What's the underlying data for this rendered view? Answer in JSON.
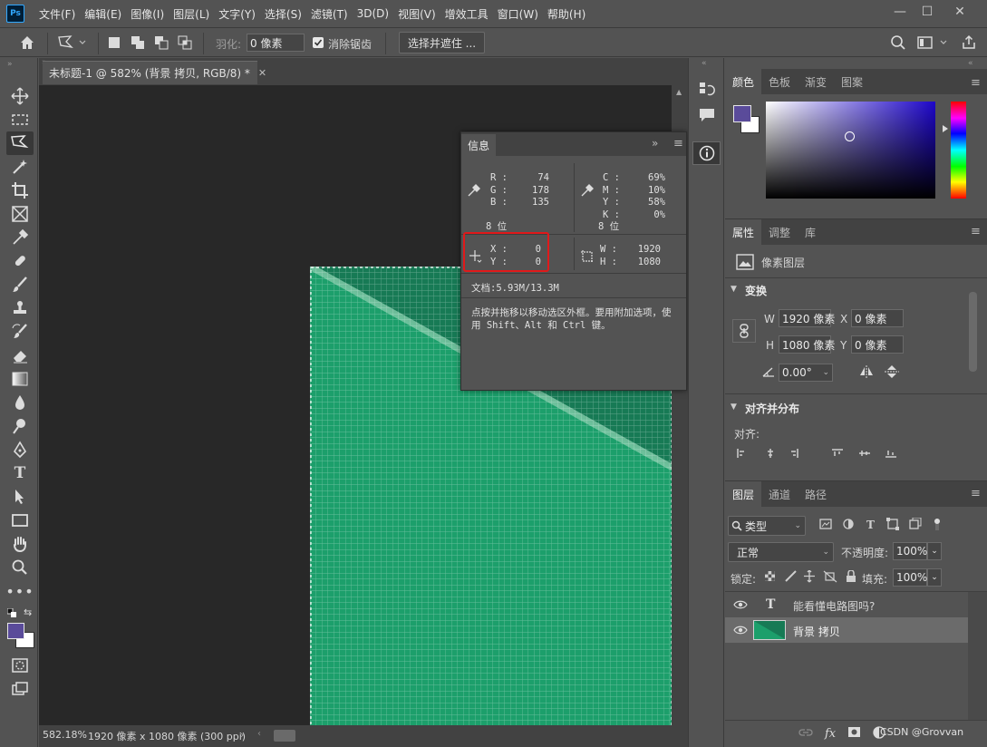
{
  "menubar": {
    "logo": "Ps",
    "items": [
      "文件(F)",
      "编辑(E)",
      "图像(I)",
      "图层(L)",
      "文字(Y)",
      "选择(S)",
      "滤镜(T)",
      "3D(D)",
      "视图(V)",
      "增效工具",
      "窗口(W)",
      "帮助(H)"
    ]
  },
  "options": {
    "feather_label": "羽化:",
    "feather_value": "0 像素",
    "antialias_label": "消除锯齿",
    "select_mask_button": "选择并遮住 ..."
  },
  "document": {
    "tab_title": "未标题-1 @ 582% (背景 拷贝, RGB/8) *",
    "zoom": "582.18%",
    "size_info": "1920 像素 x 1080 像素 (300 ppi)"
  },
  "info_panel": {
    "tab": "信息",
    "rgb": {
      "R": "74",
      "G": "178",
      "B": "135"
    },
    "cmyk": {
      "C": "69%",
      "M": "10%",
      "Y": "58%",
      "K": "0%"
    },
    "bits_left": "8 位",
    "bits_right": "8 位",
    "xy": {
      "X": "0",
      "Y": "0"
    },
    "wh": {
      "W": "1920",
      "H": "1080"
    },
    "doc_size": "文档:5.93M/13.3M",
    "hint": "点按并拖移以移动选区外框。要用附加选项，使用 Shift、Alt 和 Ctrl 键。"
  },
  "color_panel": {
    "tabs": [
      "颜色",
      "色板",
      "渐变",
      "图案"
    ],
    "foreground": "#5a4b9a",
    "background": "#ffffff",
    "field_hue": "#1d06c9"
  },
  "properties_panel": {
    "tabs": [
      "属性",
      "调整",
      "库"
    ],
    "type_label": "像素图层",
    "transform_title": "变换",
    "w_label": "W",
    "w_value": "1920 像素",
    "h_label": "H",
    "h_value": "1080 像素",
    "x_label": "X",
    "x_value": "0 像素",
    "y_label": "Y",
    "y_value": "0 像素",
    "angle_value": "0.00°",
    "align_title": "对齐并分布",
    "align_label": "对齐:"
  },
  "layers_panel": {
    "tabs": [
      "图层",
      "通道",
      "路径"
    ],
    "filter_kind": "类型",
    "blend_mode": "正常",
    "opacity_label": "不透明度:",
    "opacity_value": "100%",
    "lock_label": "锁定:",
    "fill_label": "填充:",
    "fill_value": "100%",
    "layers": [
      {
        "name": "能看懂电路图吗?",
        "type": "text",
        "selected": false
      },
      {
        "name": "背景 拷贝",
        "type": "pixel",
        "selected": true
      }
    ],
    "watermark": "CSDN @Grovvan"
  },
  "colors": {
    "canvas_green": "#1c9f6b",
    "canvas_dark_green": "#177a55",
    "highlight_red": "#e0191a"
  }
}
